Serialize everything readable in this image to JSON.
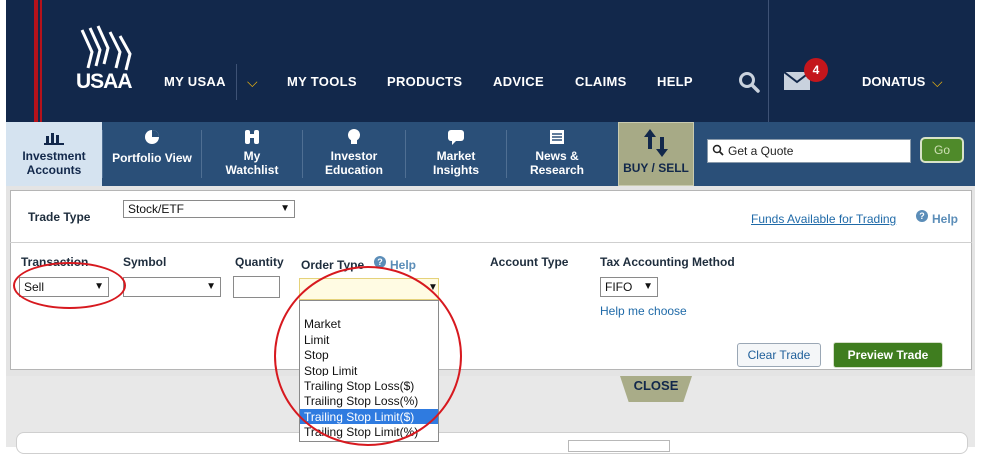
{
  "header": {
    "logo_text": "USAA",
    "nav": [
      {
        "label": "MY USAA"
      },
      {
        "label": "MY TOOLS"
      },
      {
        "label": "PRODUCTS"
      },
      {
        "label": "ADVICE"
      },
      {
        "label": "CLAIMS"
      },
      {
        "label": "HELP"
      }
    ],
    "mail_count": "4",
    "user_name": "DONATUS"
  },
  "subnav": {
    "tabs": [
      {
        "label": "Investment Accounts"
      },
      {
        "label": "Portfolio View"
      },
      {
        "label": "My Watchlist"
      },
      {
        "label": "Investor Education"
      },
      {
        "label": "Market Insights"
      },
      {
        "label": "News & Research"
      }
    ],
    "buy_sell": "BUY / SELL",
    "quote_placeholder": "Get a Quote",
    "go_label": "Go"
  },
  "trade": {
    "trade_type_label": "Trade Type",
    "trade_type_value": "Stock/ETF",
    "funds_link": "Funds Available for Trading",
    "help_label": "Help",
    "transaction_label": "Transaction",
    "transaction_value": "Sell",
    "symbol_label": "Symbol",
    "symbol_value": "",
    "quantity_label": "Quantity",
    "quantity_value": "",
    "order_type_label": "Order Type",
    "order_help": "Help",
    "order_options": [
      "Market",
      "Limit",
      "Stop",
      "Stop Limit",
      "Trailing Stop Loss($)",
      "Trailing Stop Loss(%)",
      "Trailing Stop Limit($)",
      "Trailing Stop Limit(%)"
    ],
    "order_selected_index": 6,
    "account_type_label": "Account Type",
    "tax_label": "Tax Accounting Method",
    "tax_value": "FIFO",
    "help_me_choose": "Help me choose",
    "clear_trade": "Clear Trade",
    "preview_trade": "Preview Trade",
    "close_label": "CLOSE"
  },
  "colors": {
    "header_bg": "#12284b",
    "accent_gold": "#f2b80f",
    "preview_green": "#3f7d1f",
    "highlight_blue": "#2f7be0",
    "annotation_red": "#d7191f"
  }
}
